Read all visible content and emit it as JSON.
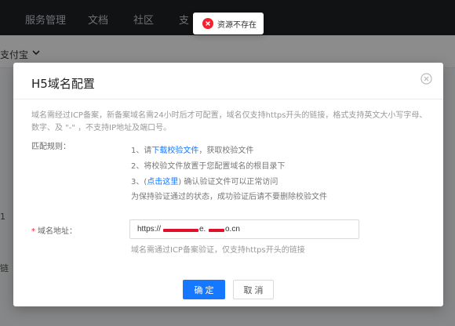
{
  "background": {
    "nav_items": [
      "服务管理",
      "文档",
      "社区",
      "支"
    ],
    "breadcrumb": "支付宝",
    "edge_text_1": "1",
    "edge_text_2": "链"
  },
  "toast": {
    "icon": "error-circle-icon",
    "text": "资源不存在",
    "color": "#f5222d"
  },
  "modal": {
    "title": "H5域名配置",
    "close_icon": "close-circle-icon",
    "intro": "域名需经过ICP备案，新备案域名需24小时后才可配置，域名仅支持https开头的链接，格式支持英文大小写字母、数字、及 \"-\" ，不支持IP地址及端口号。",
    "rule_label": "匹配规则：",
    "rules": {
      "r1_prefix": "1、请",
      "r1_link": "下载校验文件",
      "r1_suffix": "，获取校验文件",
      "r2": "2、将校验文件放置于您配置域名的根目录下",
      "r3_prefix": "3、(",
      "r3_link": "点击这里",
      "r3_suffix": ") 确认验证文件可以正常访问",
      "r4": "为保持验证通过的状态，成功验证后请不要删除校验文件"
    },
    "field": {
      "required_mark": "*",
      "label": "域名地址：",
      "value_visible_start": "https://",
      "value_visible_mid": "e.",
      "value_visible_end": "o.cn",
      "help": "域名需通过ICP备案验证，仅支持https开头的链接"
    },
    "buttons": {
      "ok": "确 定",
      "cancel": "取 消"
    },
    "colors": {
      "primary": "#1677ff",
      "link": "#1677ff",
      "redaction": "#e0102a"
    }
  }
}
